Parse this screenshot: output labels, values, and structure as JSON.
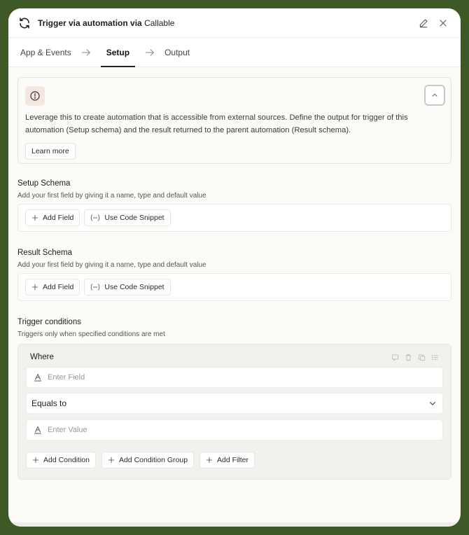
{
  "header": {
    "title": "Trigger via automation via",
    "subtitle": "Callable",
    "icons": {
      "refresh": "refresh-icon",
      "edit": "pencil-icon",
      "close": "close-icon"
    }
  },
  "tabs": [
    {
      "label": "App & Events",
      "active": false
    },
    {
      "label": "Setup",
      "active": true
    },
    {
      "label": "Output",
      "active": false
    }
  ],
  "info": {
    "text": "Leverage this to create automation that is accessible from external sources. Define the output for trigger of this automation (Setup schema) and the result returned to the parent automation (Result schema).",
    "learn_more": "Learn more"
  },
  "setup_schema": {
    "title": "Setup Schema",
    "subtitle": "Add your first field by giving it a name, type and default value",
    "add_field": "Add Field",
    "code_snippet": "Use Code Snippet"
  },
  "result_schema": {
    "title": "Result Schema",
    "subtitle": "Add your first field by giving it a name, type and default value",
    "add_field": "Add Field",
    "code_snippet": "Use Code Snippet"
  },
  "trigger_conditions": {
    "title": "Trigger conditions",
    "subtitle": "Triggers only when specified conditions are met",
    "where": "Where",
    "field_placeholder": "Enter Field",
    "operator": "Equals to",
    "value_placeholder": "Enter Value",
    "add_condition": "Add Condition",
    "add_condition_group": "Add Condition Group",
    "add_filter": "Add Filter"
  },
  "colors": {
    "background": "#3e5826",
    "panel": "#fcfbf8",
    "info_icon_bg": "#f4e7df"
  }
}
